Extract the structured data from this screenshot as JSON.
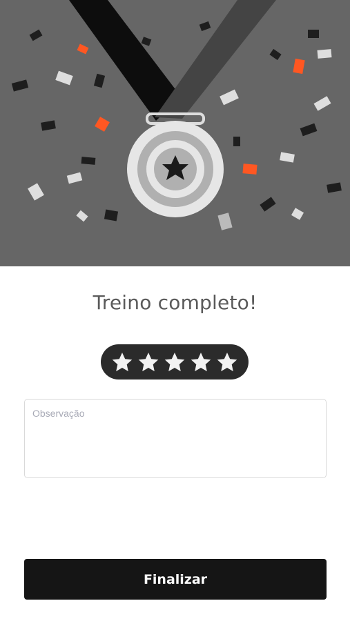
{
  "hero": {
    "illustration": "medal-with-confetti"
  },
  "title": "Treino completo!",
  "rating": {
    "value": 5,
    "max": 5,
    "icon": "star-icon"
  },
  "observation": {
    "placeholder": "Observação",
    "value": ""
  },
  "finish_button": {
    "label": "Finalizar"
  },
  "colors": {
    "hero_bg": "#666666",
    "accent": "#ff5722",
    "button": "#151515"
  }
}
